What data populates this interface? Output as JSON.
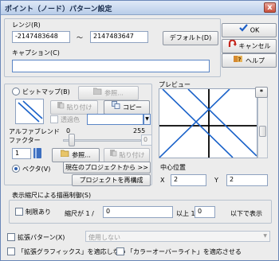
{
  "window": {
    "title": "ポイント（ノード）パターン設定",
    "close_glyph": "x"
  },
  "range": {
    "label": "レンジ(R)",
    "min": "-2147483648",
    "separator": "～",
    "max": "2147483647",
    "default_button": "デフォルト(D)"
  },
  "caption": {
    "label": "キャプション(C)",
    "value": ""
  },
  "actions": {
    "ok": "OK",
    "cancel": "キャンセル",
    "help": "ヘルプ"
  },
  "bitmap": {
    "radio_label": "ビットマップ(B)",
    "browse": "参照...",
    "paste": "貼り付け",
    "copy": "コピー",
    "transparent_label": "透過色"
  },
  "alpha": {
    "label_line1": "アルファブレンド",
    "label_line2": "ファクター",
    "min": "0",
    "max": "255",
    "value": "0"
  },
  "vector": {
    "radio_label": "ベクタ(V)",
    "browse": "参照...",
    "paste": "貼り付け",
    "from_project": "現在のプロジェクトから >>",
    "redraw_project": "プロジェクトを再構成"
  },
  "number_field": "1",
  "preview": {
    "label": "プレビュー",
    "star_button": "*",
    "center_label": "中心位置",
    "x_label": "X",
    "x_value": "2",
    "y_label": "Y",
    "y_value": "2"
  },
  "zoom_limit": {
    "label": "表示縮尺による描画制御(S)",
    "limit_check_label": "制限あり",
    "scale_prefix": "縮尺が 1 /",
    "from_value": "0",
    "middle_text": "以上  1 /",
    "to_value": "0",
    "suffix": "以下で表示"
  },
  "extended_pattern": {
    "label": "拡張パターン(X)",
    "select_value": "使用しない"
  },
  "bottom_checks": {
    "apply_ext_graphics": "「拡張グラフィックス」を適応しない",
    "apply_color_overwrite": "「カラーオーバーライト」を適応させる"
  },
  "colors": {
    "line": "#1a62c9",
    "accent": "#2d5fb0"
  }
}
